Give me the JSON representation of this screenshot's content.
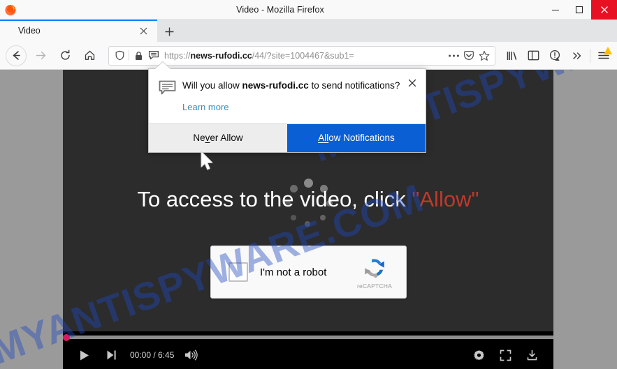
{
  "window": {
    "title": "Video - Mozilla Firefox",
    "minimize_label": "Minimize",
    "maximize_label": "Maximize",
    "close_label": "Close",
    "close_bg": "#e81123"
  },
  "tabs": {
    "items": [
      {
        "label": "Video",
        "close_label": "Close tab",
        "active": true
      }
    ],
    "new_tab_label": "+"
  },
  "navigation": {
    "back_label": "Back",
    "forward_label": "Forward",
    "reload_label": "Reload",
    "home_label": "Home"
  },
  "urlbar": {
    "shield_label": "Tracking protection",
    "lock_label": "Connection secure",
    "notification_permission_label": "Notification permission requested",
    "url_prefix": "https://",
    "url_domain": "news-rufodi.cc",
    "url_path": "/44/?site=1004467&sub1=",
    "full_url": "https://news-rufodi.cc/44/?site=1004467&sub1=",
    "page_actions_label": "•••",
    "pocket_label": "Save to Pocket",
    "bookmark_label": "Bookmark this page"
  },
  "toolbar_right": {
    "library_label": "Library",
    "sidebar_label": "Sidebar",
    "account_label": "Account",
    "overflow_label": "»",
    "menu_label": "Open menu",
    "menu_badge_color": "#ffbf00"
  },
  "page": {
    "watermark": "MYANTISPYWARE.COM",
    "watermark_color": "#1e48be",
    "background_color": "#2c2c2c",
    "cta_text": "To access to the video, click ",
    "cta_allow": "\"Allow\"",
    "cta_allow_color": "#c0392b",
    "spinner_label": "Loading"
  },
  "captcha": {
    "checkbox_label": "I'm not a robot checkbox",
    "label": "I'm not a robot",
    "brand": "reCAPTCHA"
  },
  "player": {
    "play_label": "Play",
    "next_label": "Next",
    "volume_label": "Mute",
    "time_current": "00:00",
    "time_separator": " / ",
    "time_total": "6:45",
    "time_display": "00:00 / 6:45",
    "settings_label": "Settings",
    "fullscreen_label": "Full screen",
    "download_label": "Download",
    "progress_percent": 0,
    "accent_color": "#d81b60"
  },
  "popup": {
    "question_prefix": "Will you allow ",
    "question_domain": "news-rufodi.cc",
    "question_suffix": " to send notifications?",
    "learn_more": "Learn more",
    "close_label": "✕",
    "never_allow_pre": "Ne",
    "never_allow_accel": "v",
    "never_allow_post": "er Allow",
    "never_allow_label": "Never Allow",
    "allow_accel": "All",
    "allow_post": "ow Notifications",
    "allow_label": "Allow Notifications",
    "allow_bg": "#0a5fd4"
  },
  "cursor": {
    "label": "mouse-pointer"
  }
}
